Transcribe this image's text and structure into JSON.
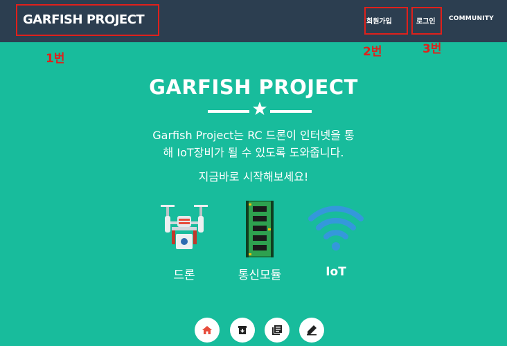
{
  "navbar": {
    "brand": "GARFISH PROJECT",
    "signup_label": "회원가입",
    "login_label": "로그인",
    "community_label": "COMMUNITY"
  },
  "annotations": {
    "label1": "1번",
    "label2": "2번",
    "label3": "3번",
    "color": "#e0201b"
  },
  "hero": {
    "title": "GARFISH PROJECT",
    "description_line1": "Garfish Project는 RC 드론이 인터넷을 통",
    "description_line2": "해 IoT장비가 될 수 있도록 도와줍니다.",
    "cta": "지금바로 시작해보세요!"
  },
  "features": [
    {
      "label": "드론",
      "icon": "drone-icon"
    },
    {
      "label": "통신모듈",
      "icon": "circuit-board-icon"
    },
    {
      "label": "IoT",
      "icon": "wifi-icon"
    }
  ],
  "footer_buttons": [
    {
      "icon": "home-icon",
      "color": "#e74c3c"
    },
    {
      "icon": "archive-icon"
    },
    {
      "icon": "library-icon"
    },
    {
      "icon": "edit-icon"
    }
  ],
  "colors": {
    "navbar": "#2c3e50",
    "hero_bg": "#18bc9c",
    "text": "#ffffff",
    "wifi": "#3498db"
  }
}
